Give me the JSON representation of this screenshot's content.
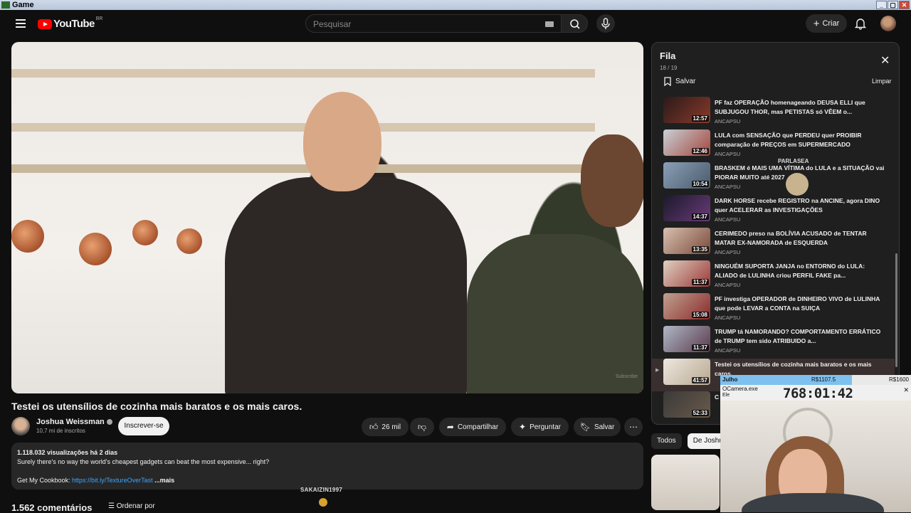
{
  "window": {
    "title": "Game",
    "buttons": [
      "_",
      "▢",
      "✕"
    ]
  },
  "header": {
    "logo_text": "YouTube",
    "region": "BR",
    "search_placeholder": "Pesquisar",
    "create_label": "Criar"
  },
  "video": {
    "title": "Testei os utensílios de cozinha mais baratos e os mais caros.",
    "watermark": "Subscribe",
    "channel": {
      "name": "Joshua Weissman",
      "subscribers": "10,7 mi de inscritos",
      "subscribe_label": "Inscrever-se"
    },
    "actions": {
      "likes": "26 mil",
      "share": "Compartilhar",
      "ask": "Perguntar",
      "save": "Salvar"
    },
    "description": {
      "stats": "1.118.032 visualizações  há 2 dias",
      "line1": "Surely there's no way the world's cheapest gadgets can beat the most expensive... right?",
      "cookbook_label": "Get My Cookbook: ",
      "cookbook_link": "https://bit.ly/TextureOverTast",
      "more": "...mais"
    },
    "comments": {
      "count_label": "1.562 comentários",
      "sort_label": "Ordenar por"
    }
  },
  "queue": {
    "title": "Fila",
    "position": "18 / 19",
    "save_label": "Salvar",
    "clear_label": "Limpar",
    "items": [
      {
        "title": "PF faz OPERAÇÃO homenageando DEUSA ELLI que SUBJUGOU THOR, mas PETISTAS só VÊEM o...",
        "channel": "ANCAPSU",
        "duration": "12:57",
        "color": "#8a3a2a"
      },
      {
        "title": "LULA com SENSAÇÃO que PERDEU quer PROIBIR comparação de PREÇOS em SUPERMERCADO",
        "channel": "ANCAPSU",
        "duration": "12:46",
        "color": "#a4463a"
      },
      {
        "title": "BRASKEM é MAIS UMA VÍTIMA do LULA e a SITUAÇÃO vai PIORAR MUITO até 2027",
        "channel": "ANCAPSU",
        "duration": "10:54",
        "color": "#4a5a6a"
      },
      {
        "title": "DARK HORSE recebe REGISTRO na ANCINE, agora DINO quer ACELERAR as INVESTIGAÇÕES",
        "channel": "ANCAPSU",
        "duration": "14:37",
        "color": "#3a3a5a"
      },
      {
        "title": "CERIMEDO preso na BOLÍVIA ACUSADO de TENTAR MATAR EX-NAMORADA de ESQUERDA",
        "channel": "ANCAPSU",
        "duration": "13:35",
        "color": "#7a4a3a"
      },
      {
        "title": "NINGUÉM SUPORTA JANJA no ENTORNO do LULA: ALIADO de LULINHA criou PERFIL FAKE pa...",
        "channel": "ANCAPSU",
        "duration": "11:37",
        "color": "#9a3a3a"
      },
      {
        "title": "PF investiga OPERADOR de DINHEIRO VIVO de LULINHA que pode LEVAR a CONTA na SUIÇA",
        "channel": "ANCAPSU",
        "duration": "15:08",
        "color": "#8a2a2a"
      },
      {
        "title": "TRUMP tá NAMORANDO? COMPORTAMENTO ERRÁTICO de TRUMP tem sido ATRIBUIDO a...",
        "channel": "ANCAPSU",
        "duration": "11:37",
        "color": "#5a3a4a"
      },
      {
        "title": "Testei os utensílios de cozinha mais baratos e os mais caros.",
        "channel": "",
        "duration": "41:57",
        "color": "#cdbfae"
      },
      {
        "title": "C",
        "channel": "",
        "duration": "52:33",
        "color": "#6a5a4a"
      }
    ]
  },
  "chips": [
    "Todos",
    "De Joshua"
  ],
  "overlays": {
    "viewer_name": "SAKAIZIN1997",
    "floating_name": "PARLASEA",
    "stream_goal": {
      "month": "Julho",
      "current": "R$1107.5",
      "goal": "R$1600",
      "progress": 0.69
    },
    "camera": {
      "window_name": "OCamera.exe",
      "sub": "Ele",
      "timer": "768:01:42"
    }
  }
}
